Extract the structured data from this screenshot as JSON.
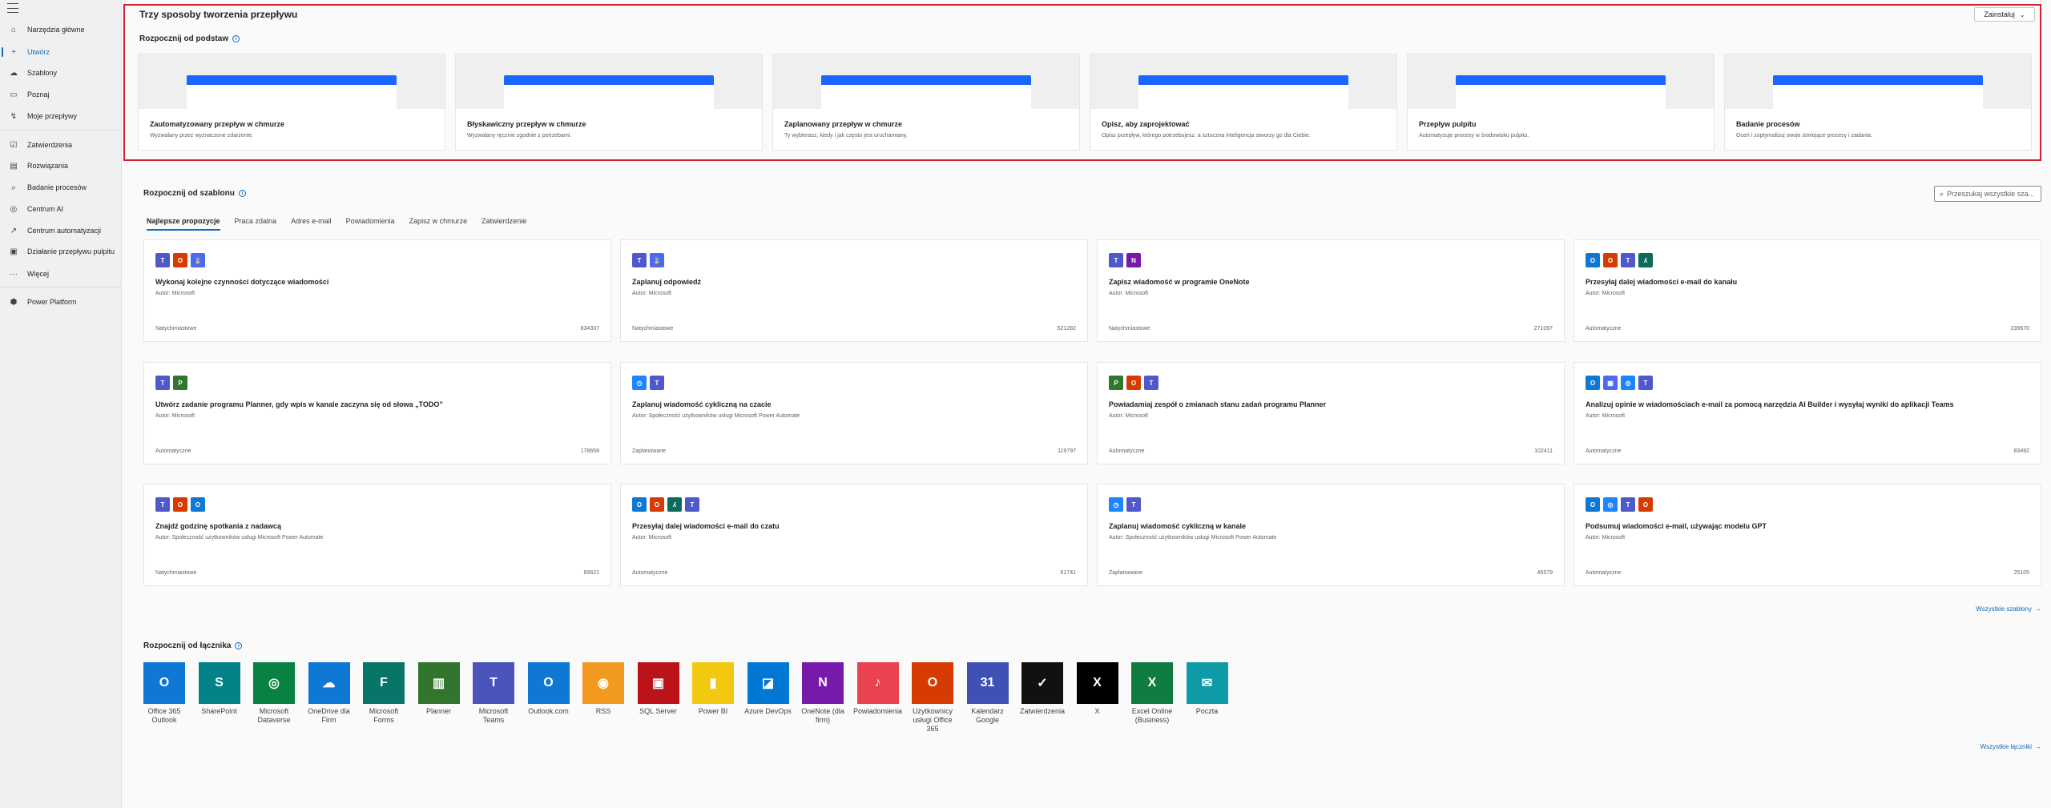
{
  "sidebar": {
    "items": [
      {
        "label": "Narzędzia główne",
        "icon": "home-icon",
        "glyph": "⌂"
      },
      {
        "label": "Utwórz",
        "icon": "plus-icon",
        "glyph": "+"
      },
      {
        "label": "Szablony",
        "icon": "templates-icon",
        "glyph": "☁"
      },
      {
        "label": "Poznaj",
        "icon": "book-icon",
        "glyph": "▭"
      },
      {
        "label": "Moje przepływy",
        "icon": "flows-icon",
        "glyph": "↯"
      },
      {
        "label": "Zatwierdzenia",
        "icon": "approvals-icon",
        "glyph": "☑"
      },
      {
        "label": "Rozwiązania",
        "icon": "solutions-icon",
        "glyph": "▤"
      },
      {
        "label": "Badanie procesów",
        "icon": "process-mining-icon",
        "glyph": "⌕"
      },
      {
        "label": "Centrum AI",
        "icon": "ai-hub-icon",
        "glyph": "◎"
      },
      {
        "label": "Centrum automatyzacji",
        "icon": "automation-center-icon",
        "glyph": "↗"
      },
      {
        "label": "Działanie przepływu pulpitu",
        "icon": "desktop-flow-icon",
        "glyph": "▣"
      },
      {
        "label": "Więcej",
        "icon": "more-icon",
        "glyph": "···"
      },
      {
        "label": "Power Platform",
        "icon": "power-platform-icon",
        "glyph": "⬢"
      }
    ]
  },
  "header": {
    "title": "Trzy sposoby tworzenia przepływu",
    "install_label": "Zainstaluj"
  },
  "start_blank": {
    "title": "Rozpocznij od podstaw",
    "cards": [
      {
        "title": "Zautomatyzowany przepływ w chmurze",
        "desc": "Wyzwalany przez wyznaczone zdarzenie."
      },
      {
        "title": "Błyskawiczny przepływ w chmurze",
        "desc": "Wyzwalany ręcznie zgodnie z potrzebami."
      },
      {
        "title": "Zaplanowany przepływ w chmurze",
        "desc": "Ty wybierasz, kiedy i jak często jest uruchamiany."
      },
      {
        "title": "Opisz, aby zaprojektować",
        "desc": "Opisz przepływ, którego potrzebujesz, a sztuczna inteligencja stworzy go dla Ciebie."
      },
      {
        "title": "Przepływ pulpitu",
        "desc": "Automatyzuje procesy w środowisku pulpitu."
      },
      {
        "title": "Badanie procesów",
        "desc": "Oceń i zoptymalizuj swoje istniejące procesy i zadania."
      }
    ]
  },
  "templates": {
    "title": "Rozpocznij od szablonu",
    "search_placeholder": "Przeszukaj wszystkie sza...",
    "tabs": [
      "Najlepsze propozycje",
      "Praca zdalna",
      "Adres e-mail",
      "Powiadomienia",
      "Zapisz w chmurze",
      "Zatwierdzenie"
    ],
    "cards": [
      {
        "title": "Wykonaj kolejne czynności dotyczące wiadomości",
        "author": "Autor: Microsoft",
        "type": "Natychmiastowe",
        "count": "834337",
        "icons": [
          {
            "color": "#5059c9",
            "glyph": "T"
          },
          {
            "color": "#d83b01",
            "glyph": "O"
          },
          {
            "color": "#4f6bed",
            "glyph": "⌛"
          }
        ]
      },
      {
        "title": "Zaplanuj odpowiedź",
        "author": "Autor: Microsoft",
        "type": "Natychmiastowe",
        "count": "521282",
        "icons": [
          {
            "color": "#5059c9",
            "glyph": "T"
          },
          {
            "color": "#4f6bed",
            "glyph": "⌛"
          }
        ]
      },
      {
        "title": "Zapisz wiadomość w programie OneNote",
        "author": "Autor: Microsoft",
        "type": "Natychmiastowe",
        "count": "271097",
        "icons": [
          {
            "color": "#5059c9",
            "glyph": "T"
          },
          {
            "color": "#7719aa",
            "glyph": "N"
          }
        ]
      },
      {
        "title": "Przesyłaj dalej wiadomości e-mail do kanału",
        "author": "Autor: Microsoft",
        "type": "Automatyczne",
        "count": "239670",
        "icons": [
          {
            "color": "#0f78d4",
            "glyph": "O"
          },
          {
            "color": "#d83b01",
            "glyph": "O"
          },
          {
            "color": "#5059c9",
            "glyph": "T"
          },
          {
            "color": "#0b6a5b",
            "glyph": "ʎ"
          }
        ]
      },
      {
        "title": "Utwórz zadanie programu Planner, gdy wpis w kanale zaczyna się od słowa „TODO”",
        "author": "Autor: Microsoft",
        "type": "Automatyczne",
        "count": "178658",
        "icons": [
          {
            "color": "#5059c9",
            "glyph": "T"
          },
          {
            "color": "#31752f",
            "glyph": "P"
          }
        ]
      },
      {
        "title": "Zaplanuj wiadomość cykliczną na czacie",
        "author": "Autor: Społeczność użytkowników usługi Microsoft Power Automate",
        "type": "Zaplanowane",
        "count": "119797",
        "icons": [
          {
            "color": "#1f85ff",
            "glyph": "◷"
          },
          {
            "color": "#5059c9",
            "glyph": "T"
          }
        ]
      },
      {
        "title": "Powiadamiaj zespół o zmianach stanu zadań programu Planner",
        "author": "Autor: Microsoft",
        "type": "Automatyczne",
        "count": "102411",
        "icons": [
          {
            "color": "#31752f",
            "glyph": "P"
          },
          {
            "color": "#d83b01",
            "glyph": "O"
          },
          {
            "color": "#5059c9",
            "glyph": "T"
          }
        ]
      },
      {
        "title": "Analizuj opinie w wiadomościach e-mail za pomocą narzędzia AI Builder i wysyłaj wyniki do aplikacji Teams",
        "author": "Autor: Microsoft",
        "type": "Automatyczne",
        "count": "83492",
        "icons": [
          {
            "color": "#0f78d4",
            "glyph": "O"
          },
          {
            "color": "#4f6bed",
            "glyph": "▦"
          },
          {
            "color": "#1f85ff",
            "glyph": "◎"
          },
          {
            "color": "#5059c9",
            "glyph": "T"
          }
        ]
      },
      {
        "title": "Znajdź godzinę spotkania z nadawcą",
        "author": "Autor: Społeczność użytkowników usługi Microsoft Power Automate",
        "type": "Natychmiastowe",
        "count": "69621",
        "icons": [
          {
            "color": "#5059c9",
            "glyph": "T"
          },
          {
            "color": "#d83b01",
            "glyph": "O"
          },
          {
            "color": "#0f78d4",
            "glyph": "O"
          }
        ]
      },
      {
        "title": "Przesyłaj dalej wiadomości e-mail do czatu",
        "author": "Autor: Microsoft",
        "type": "Automatyczne",
        "count": "61741",
        "icons": [
          {
            "color": "#0f78d4",
            "glyph": "O"
          },
          {
            "color": "#d83b01",
            "glyph": "O"
          },
          {
            "color": "#0b6a5b",
            "glyph": "ʎ"
          },
          {
            "color": "#5059c9",
            "glyph": "T"
          }
        ]
      },
      {
        "title": "Zaplanuj wiadomość cykliczną w kanale",
        "author": "Autor: Społeczność użytkowników usługi Microsoft Power Automate",
        "type": "Zaplanowane",
        "count": "45579",
        "icons": [
          {
            "color": "#1f85ff",
            "glyph": "◷"
          },
          {
            "color": "#5059c9",
            "glyph": "T"
          }
        ]
      },
      {
        "title": "Podsumuj wiadomości e-mail, używając modelu GPT",
        "author": "Autor: Microsoft",
        "type": "Automatyczne",
        "count": "25105",
        "icons": [
          {
            "color": "#0f78d4",
            "glyph": "O"
          },
          {
            "color": "#1f85ff",
            "glyph": "◎"
          },
          {
            "color": "#5059c9",
            "glyph": "T"
          },
          {
            "color": "#d83b01",
            "glyph": "O"
          }
        ]
      }
    ],
    "all_link": "Wszystkie szablony"
  },
  "connectors": {
    "title": "Rozpocznij od łącznika",
    "items": [
      {
        "label": "Office 365 Outlook",
        "color": "#0f78d4",
        "glyph": "O",
        "icon": "office365-outlook-icon"
      },
      {
        "label": "SharePoint",
        "color": "#038387",
        "glyph": "S",
        "icon": "sharepoint-icon"
      },
      {
        "label": "Microsoft Dataverse",
        "color": "#088142",
        "glyph": "◎",
        "icon": "dataverse-icon"
      },
      {
        "label": "OneDrive dla Firm",
        "color": "#0f78d4",
        "glyph": "☁",
        "icon": "onedrive-icon"
      },
      {
        "label": "Microsoft Forms",
        "color": "#077568",
        "glyph": "F",
        "icon": "forms-icon"
      },
      {
        "label": "Planner",
        "color": "#31752f",
        "glyph": "▥",
        "icon": "planner-icon"
      },
      {
        "label": "Microsoft Teams",
        "color": "#4b53bc",
        "glyph": "T",
        "icon": "teams-icon"
      },
      {
        "label": "Outlook.com",
        "color": "#0f78d4",
        "glyph": "O",
        "icon": "outlook-com-icon"
      },
      {
        "label": "RSS",
        "color": "#f29a1f",
        "glyph": "◉",
        "icon": "rss-icon"
      },
      {
        "label": "SQL Server",
        "color": "#ba141a",
        "glyph": "▣",
        "icon": "sql-server-icon"
      },
      {
        "label": "Power BI",
        "color": "#f2c811",
        "glyph": "▮",
        "icon": "power-bi-icon"
      },
      {
        "label": "Azure DevOps",
        "color": "#0078d4",
        "glyph": "◪",
        "icon": "azure-devops-icon"
      },
      {
        "label": "OneNote (dla firm)",
        "color": "#7719aa",
        "glyph": "N",
        "icon": "onenote-icon"
      },
      {
        "label": "Powiadomienia",
        "color": "#e8434f",
        "glyph": "♪",
        "icon": "notifications-icon"
      },
      {
        "label": "Użytkownicy usługi Office 365",
        "color": "#d83b01",
        "glyph": "O",
        "icon": "office365-users-icon"
      },
      {
        "label": "Kalendarz Google",
        "color": "#3f51b5",
        "glyph": "31",
        "icon": "google-calendar-icon"
      },
      {
        "label": "Zatwierdzenia",
        "color": "#111111",
        "glyph": "✓",
        "icon": "approvals-connector-icon"
      },
      {
        "label": "X",
        "color": "#000000",
        "glyph": "X",
        "icon": "x-icon"
      },
      {
        "label": "Excel Online (Business)",
        "color": "#107c41",
        "glyph": "X",
        "icon": "excel-icon"
      },
      {
        "label": "Poczta",
        "color": "#0f9aa8",
        "glyph": "✉",
        "icon": "mail-icon"
      }
    ],
    "all_link": "Wszystkie łączniki"
  }
}
